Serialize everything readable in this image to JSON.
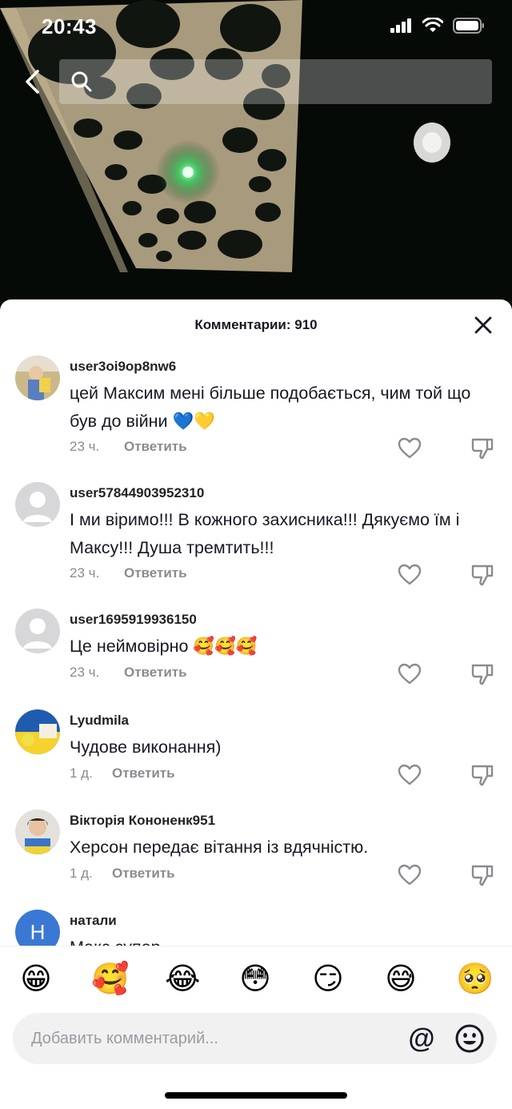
{
  "status_bar": {
    "time": "20:43"
  },
  "search": {
    "placeholder": ""
  },
  "comments_header": {
    "title": "Комментарии: 910"
  },
  "comments": [
    {
      "username": "user3oi9op8nw6",
      "text": "цей Максим мені більше подобається, чим той що був до війни 💙💛",
      "time": "23 ч.",
      "reply_label": "Ответить",
      "avatar_type": "photo"
    },
    {
      "username": "user57844903952310",
      "text": "І ми віримо!!! В кожного захисника!!! Дякуємо їм і Максу!!! Душа тремтить!!!",
      "time": "23 ч.",
      "reply_label": "Ответить",
      "avatar_type": "default"
    },
    {
      "username": "user1695919936150",
      "text": "Це неймовірно 🥰🥰🥰",
      "time": "23 ч.",
      "reply_label": "Ответить",
      "avatar_type": "default"
    },
    {
      "username": "Lyudmila",
      "text": "Чудове виконання)",
      "time": "1 д.",
      "reply_label": "Ответить",
      "avatar_type": "photo"
    },
    {
      "username": "Вікторія Кононенк951",
      "text": "Херсон передає вітання із вдячністю.",
      "time": "1 д.",
      "reply_label": "Ответить",
      "avatar_type": "photo"
    },
    {
      "username": "натали",
      "text": "Макс супер",
      "avatar_type": "letter",
      "avatar_letter": "Н"
    }
  ],
  "emoji_bar": [
    "😁",
    "🥰",
    "😂",
    "😳",
    "😏",
    "😅",
    "🥺"
  ],
  "comment_input": {
    "placeholder": "Добавить комментарий...",
    "mention_symbol": "@"
  },
  "icons": {
    "back": "chevron-left-icon",
    "search": "search-icon",
    "close": "close-icon",
    "like": "heart-outline-icon",
    "dislike": "thumbs-down-icon",
    "emoji_picker": "smiley-icon"
  },
  "colors": {
    "text_primary": "#161823",
    "text_secondary": "#8a8b91",
    "avatar_letter_bg": "#3a78d4"
  }
}
